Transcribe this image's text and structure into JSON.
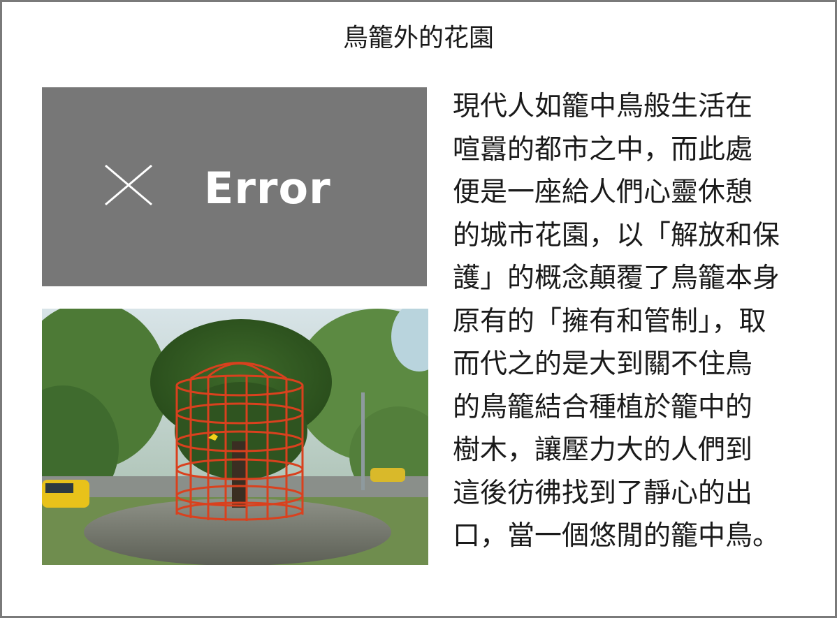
{
  "title": "鳥籠外的花園",
  "error_placeholder": {
    "label": "Error",
    "icon": "close-x-icon"
  },
  "photo": {
    "subject": "orange-cage-around-tree"
  },
  "paragraph_lines": [
    "現代人如籠中鳥般生活在",
    "喧囂的都市之中，而此處",
    "便是一座給人們心靈休憩",
    "的城市花園，以「解放和保",
    "護」的概念顛覆了鳥籠本身",
    "原有的「擁有和管制」，取",
    "而代之的是大到關不住鳥",
    "的鳥籠結合種植於籠中的",
    "樹木，讓壓力大的人們到",
    "這後彷彿找到了靜心的出",
    "口，當一個悠閒的籠中鳥。"
  ],
  "colors": {
    "border": "#7a7a7a",
    "error_bg": "#777777",
    "cage": "#d9411e"
  }
}
